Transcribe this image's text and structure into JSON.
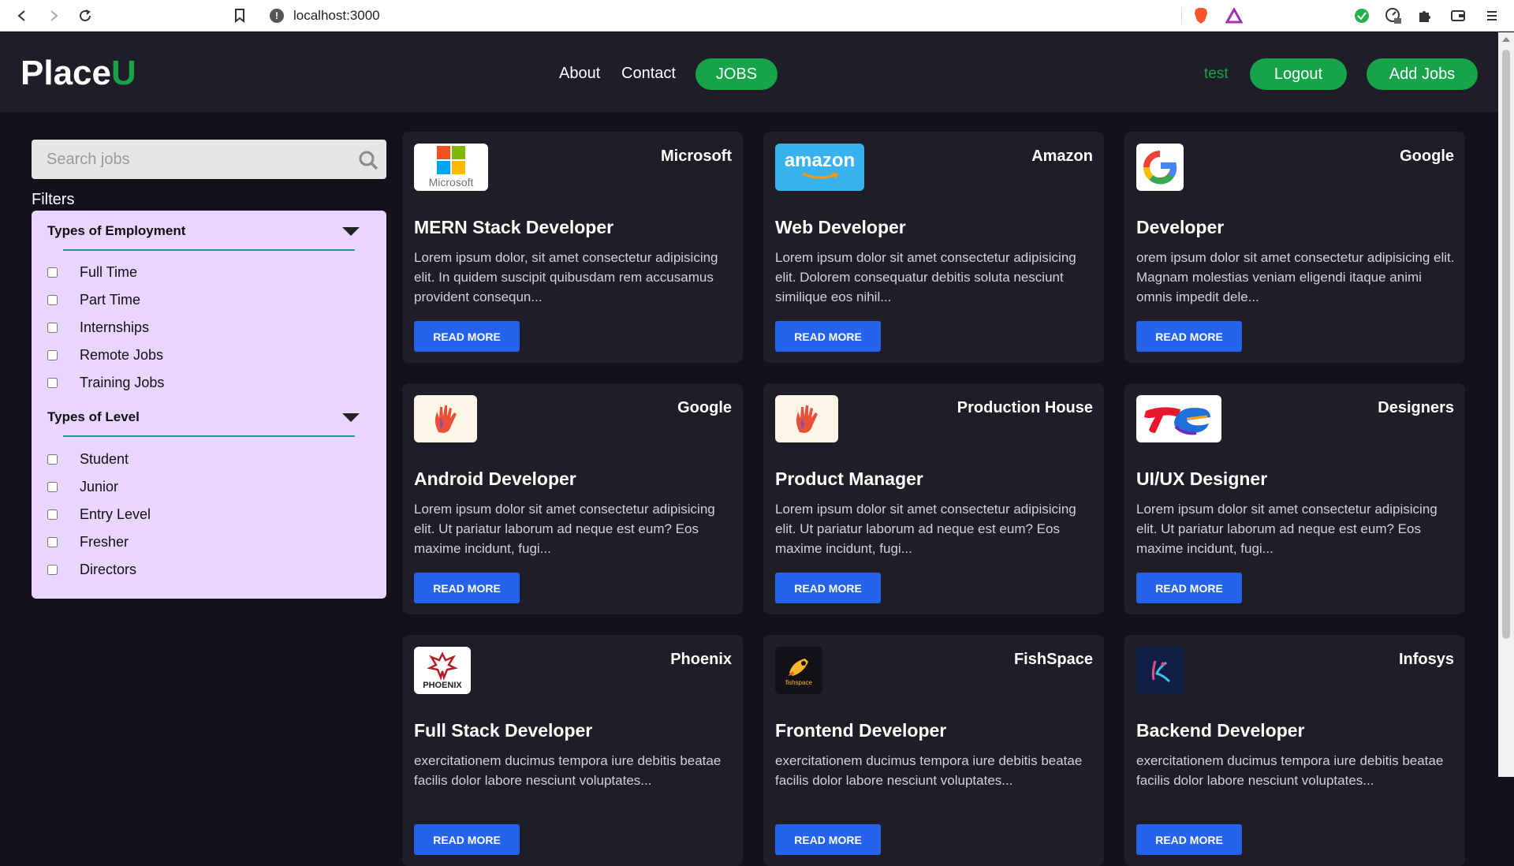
{
  "browser": {
    "url": "localhost:3000"
  },
  "header": {
    "logo_main": "Place",
    "logo_accent": "U",
    "nav": [
      {
        "label": "About"
      },
      {
        "label": "Contact"
      },
      {
        "label": "JOBS"
      }
    ],
    "username": "test",
    "logout_label": "Logout",
    "add_jobs_label": "Add Jobs"
  },
  "sidebar": {
    "search_placeholder": "Search jobs",
    "filters_title": "Filters",
    "groups": [
      {
        "title": "Types of Employment",
        "options": [
          "Full Time",
          "Part Time",
          "Internships",
          "Remote Jobs",
          "Training Jobs"
        ]
      },
      {
        "title": "Types of Level",
        "options": [
          "Student",
          "Junior",
          "Entry Level",
          "Fresher",
          "Directors"
        ]
      }
    ]
  },
  "jobs": [
    {
      "company": "Microsoft",
      "logo": "microsoft-logo",
      "logo_text": "Microsoft",
      "title": "MERN Stack Developer",
      "desc": "Lorem ipsum dolor, sit amet consectetur adipisicing elit. In quidem suscipit quibusdam rem accusamus provident consequn...",
      "button": "READ MORE"
    },
    {
      "company": "Amazon",
      "logo": "amazon-logo",
      "logo_text": "amazon",
      "title": "Web Developer",
      "desc": "Lorem ipsum dolor sit amet consectetur adipisicing elit. Dolorem consequatur debitis soluta nesciunt similique eos nihil...",
      "button": "READ MORE"
    },
    {
      "company": "Google",
      "logo": "google-logo",
      "logo_text": "G",
      "title": "Developer",
      "desc": "orem ipsum dolor sit amet consectetur adipisicing elit. Magnam molestias veniam eligendi itaque animi omnis impedit dele...",
      "button": "READ MORE"
    },
    {
      "company": "Google",
      "logo": "hand-logo",
      "title": "Android Developer",
      "desc": "Lorem ipsum dolor sit amet consectetur adipisicing elit. Ut pariatur laborum ad neque est eum? Eos maxime incidunt, fugi...",
      "button": "READ MORE"
    },
    {
      "company": "Production House",
      "logo": "hand-logo",
      "title": "Product Manager",
      "desc": "Lorem ipsum dolor sit amet consectetur adipisicing elit. Ut pariatur laborum ad neque est eum? Eos maxime incidunt, fugi...",
      "button": "READ MORE"
    },
    {
      "company": "Designers",
      "logo": "totalenergies-logo",
      "title": "UI/UX Designer",
      "desc": "Lorem ipsum dolor sit amet consectetur adipisicing elit. Ut pariatur laborum ad neque est eum? Eos maxime incidunt, fugi...",
      "button": "READ MORE"
    },
    {
      "company": "Phoenix",
      "logo": "phoenix-logo",
      "logo_text": "PHOENIX",
      "title": "Full Stack Developer",
      "desc": "exercitationem ducimus tempora iure debitis beatae facilis dolor labore nesciunt voluptates...",
      "button": "READ MORE"
    },
    {
      "company": "FishSpace",
      "logo": "fishspace-logo",
      "logo_text": "fishspace",
      "title": "Frontend Developer",
      "desc": "exercitationem ducimus tempora iure debitis beatae facilis dolor labore nesciunt voluptates...",
      "button": "READ MORE"
    },
    {
      "company": "Infosys",
      "logo": "infosys-logo",
      "title": "Backend Developer",
      "desc": "exercitationem ducimus tempora iure debitis beatae facilis dolor labore nesciunt voluptates...",
      "button": "READ MORE"
    }
  ],
  "colors": {
    "page_bg": "#13121c",
    "panel_bg": "#1e1d28",
    "accent_green": "#16a34a",
    "button_blue": "#2563eb",
    "filter_bg": "#e9d5ff"
  }
}
